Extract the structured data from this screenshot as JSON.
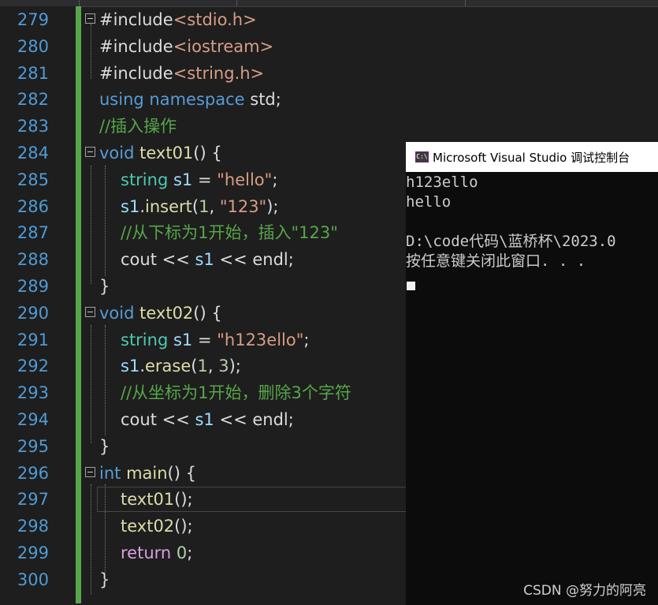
{
  "editor": {
    "lines": [
      {
        "num": "279",
        "tokens": [
          {
            "t": "#include",
            "c": "p"
          },
          {
            "t": "<stdio.h>",
            "c": "inc"
          }
        ]
      },
      {
        "num": "280",
        "tokens": [
          {
            "t": "#include",
            "c": "p"
          },
          {
            "t": "<iostream>",
            "c": "inc"
          }
        ]
      },
      {
        "num": "281",
        "tokens": [
          {
            "t": "#include",
            "c": "p"
          },
          {
            "t": "<string.h>",
            "c": "inc"
          }
        ]
      },
      {
        "num": "282",
        "tokens": [
          {
            "t": "using ",
            "c": "k"
          },
          {
            "t": "namespace ",
            "c": "k"
          },
          {
            "t": "std;",
            "c": "p"
          }
        ]
      },
      {
        "num": "283",
        "tokens": [
          {
            "t": "//插入操作",
            "c": "c"
          }
        ]
      },
      {
        "num": "284",
        "tokens": [
          {
            "t": "void ",
            "c": "k"
          },
          {
            "t": "text01",
            "c": "f"
          },
          {
            "t": "() {",
            "c": "p"
          }
        ]
      },
      {
        "num": "285",
        "tokens": [
          {
            "t": "string ",
            "c": "t"
          },
          {
            "t": "s1",
            "c": "v"
          },
          {
            "t": " = ",
            "c": "p"
          },
          {
            "t": "\"hello\"",
            "c": "s"
          },
          {
            "t": ";",
            "c": "p"
          }
        ]
      },
      {
        "num": "286",
        "tokens": [
          {
            "t": "s1",
            "c": "v"
          },
          {
            "t": ".",
            "c": "p"
          },
          {
            "t": "insert",
            "c": "f"
          },
          {
            "t": "(",
            "c": "p"
          },
          {
            "t": "1",
            "c": "n"
          },
          {
            "t": ", ",
            "c": "p"
          },
          {
            "t": "\"123\"",
            "c": "s"
          },
          {
            "t": ");",
            "c": "p"
          }
        ]
      },
      {
        "num": "287",
        "tokens": [
          {
            "t": "//从下标为1开始，插入\"123\"",
            "c": "c"
          }
        ]
      },
      {
        "num": "288",
        "tokens": [
          {
            "t": "cout",
            "c": "p"
          },
          {
            "t": " << ",
            "c": "p"
          },
          {
            "t": "s1",
            "c": "v"
          },
          {
            "t": " << ",
            "c": "p"
          },
          {
            "t": "endl",
            "c": "p"
          },
          {
            "t": ";",
            "c": "p"
          }
        ]
      },
      {
        "num": "289",
        "tokens": [
          {
            "t": "}",
            "c": "p"
          }
        ]
      },
      {
        "num": "290",
        "tokens": [
          {
            "t": "void ",
            "c": "k"
          },
          {
            "t": "text02",
            "c": "f"
          },
          {
            "t": "() {",
            "c": "p"
          }
        ]
      },
      {
        "num": "291",
        "tokens": [
          {
            "t": "string ",
            "c": "t"
          },
          {
            "t": "s1",
            "c": "v"
          },
          {
            "t": " = ",
            "c": "p"
          },
          {
            "t": "\"h123ello\"",
            "c": "s"
          },
          {
            "t": ";",
            "c": "p"
          }
        ]
      },
      {
        "num": "292",
        "tokens": [
          {
            "t": "s1",
            "c": "v"
          },
          {
            "t": ".",
            "c": "p"
          },
          {
            "t": "erase",
            "c": "f"
          },
          {
            "t": "(",
            "c": "p"
          },
          {
            "t": "1",
            "c": "n"
          },
          {
            "t": ", ",
            "c": "p"
          },
          {
            "t": "3",
            "c": "n"
          },
          {
            "t": ");",
            "c": "p"
          }
        ]
      },
      {
        "num": "293",
        "tokens": [
          {
            "t": "//从坐标为1开始，删除3个字符",
            "c": "c"
          }
        ]
      },
      {
        "num": "294",
        "tokens": [
          {
            "t": "cout",
            "c": "p"
          },
          {
            "t": " << ",
            "c": "p"
          },
          {
            "t": "s1",
            "c": "v"
          },
          {
            "t": " << ",
            "c": "p"
          },
          {
            "t": "endl",
            "c": "p"
          },
          {
            "t": ";",
            "c": "p"
          }
        ]
      },
      {
        "num": "295",
        "tokens": [
          {
            "t": "}",
            "c": "p"
          }
        ]
      },
      {
        "num": "296",
        "tokens": [
          {
            "t": "int ",
            "c": "k"
          },
          {
            "t": "main",
            "c": "f"
          },
          {
            "t": "() {",
            "c": "p"
          }
        ]
      },
      {
        "num": "297",
        "tokens": [
          {
            "t": "text01",
            "c": "f"
          },
          {
            "t": "();",
            "c": "p"
          }
        ]
      },
      {
        "num": "298",
        "tokens": [
          {
            "t": "text02",
            "c": "f"
          },
          {
            "t": "();",
            "c": "p"
          }
        ]
      },
      {
        "num": "299",
        "tokens": [
          {
            "t": "return ",
            "c": "ctl"
          },
          {
            "t": "0",
            "c": "n"
          },
          {
            "t": ";",
            "c": "p"
          }
        ]
      },
      {
        "num": "300",
        "tokens": [
          {
            "t": "}",
            "c": "p"
          }
        ]
      }
    ]
  },
  "console": {
    "title": "Microsoft Visual Studio 调试控制台",
    "icon_name": "console-app-icon",
    "icon_text": "C:\\",
    "lines": [
      "h123ello",
      "hello",
      "",
      "D:\\code代码\\蓝桥杯\\2023.0",
      "按任意键关闭此窗口. . ."
    ]
  },
  "watermark": "CSDN @努力的阿亮",
  "colors": {
    "editor_bg": "#1e1e1e",
    "line_number": "#4f9bd6",
    "keyword": "#569cd6",
    "comment": "#57a64a",
    "string": "#d69d85",
    "type": "#4ec9b0",
    "function": "#dcdcaa",
    "variable": "#9cdcfe",
    "number": "#b5cea8",
    "control": "#d8a0df",
    "console_bg": "#0c0c0c"
  }
}
